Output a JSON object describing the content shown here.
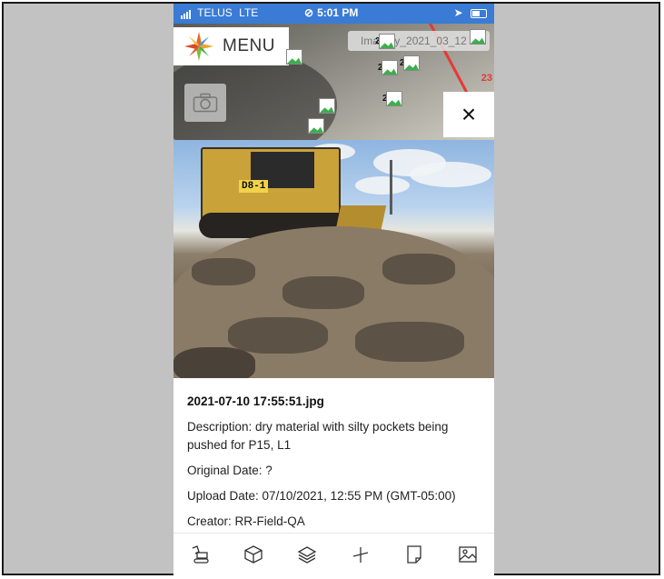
{
  "status_bar": {
    "carrier": "TELUS",
    "network": "LTE",
    "time": "5:01 PM"
  },
  "map": {
    "menu_label": "MENU",
    "layer_chip": "Imagery_2021_03_12",
    "route_label": "23",
    "markers": [
      {
        "count": "2"
      },
      {
        "count": "2"
      },
      {
        "count": "2"
      },
      {
        "count": ""
      },
      {
        "count": ""
      },
      {
        "count": ""
      }
    ],
    "close_symbol": "×"
  },
  "photo": {
    "machine_tag": "D8-1"
  },
  "details": {
    "filename": "2021-07-10 17:55:51.jpg",
    "description": "Description: dry material with silty pockets being pushed for P15, L1",
    "original_date": "Original Date: ?",
    "upload_date": "Upload Date: 07/10/2021, 12:55 PM (GMT-05:00)",
    "creator": "Creator: RR-Field-QA"
  },
  "toolbar": {
    "items": [
      {
        "icon": "excavator-icon"
      },
      {
        "icon": "cube-icon"
      },
      {
        "icon": "layers-icon"
      },
      {
        "icon": "measure-icon"
      },
      {
        "icon": "note-icon"
      },
      {
        "icon": "image-icon"
      }
    ]
  },
  "colors": {
    "status_bar": "#3a7bd5",
    "frame_bg": "#c2c2c2",
    "route_red": "#e53935",
    "marker_green": "#3cae4e"
  }
}
